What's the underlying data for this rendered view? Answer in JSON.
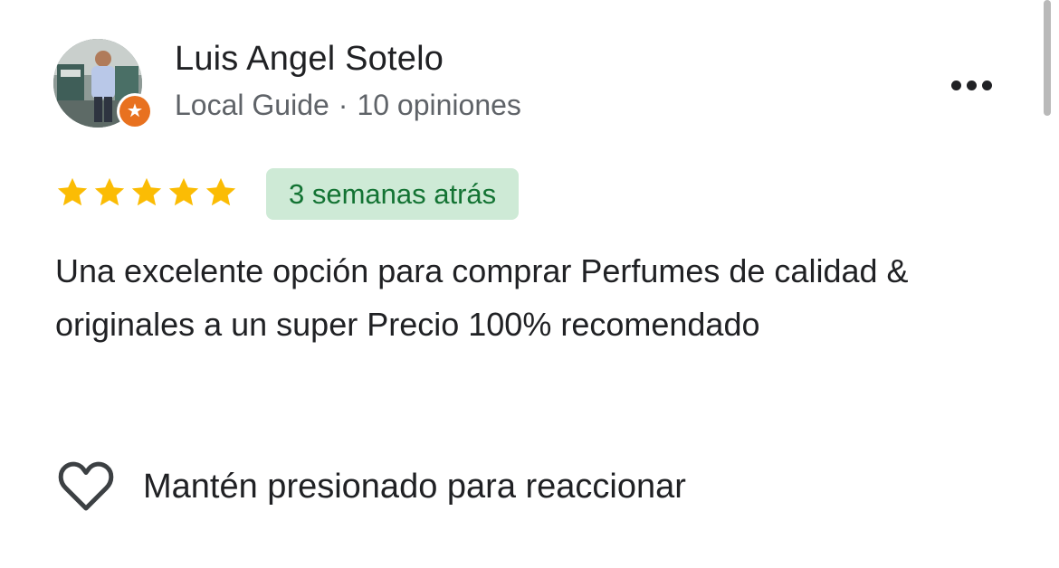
{
  "reviewer": {
    "name": "Luis Angel Sotelo",
    "role": "Local Guide",
    "separator": "·",
    "reviews_count": "10 opiniones",
    "avatar_icon": "reviewer-photo",
    "badge_icon": "local-guide-star-badge",
    "badge_color": "#e8711f"
  },
  "menu": {
    "icon": "more-horizontal-icon"
  },
  "rating": {
    "stars": 5,
    "max": 5,
    "star_color": "#fbbc04"
  },
  "time_ago": "3 semanas atrás",
  "review_text": "Una excelente opción para comprar Perfumes de calidad & originales a un super Precio 100% recomendado",
  "reaction": {
    "icon": "heart-outline-icon",
    "label": "Mantén presionado para reaccionar"
  },
  "colors": {
    "text_primary": "#202124",
    "text_secondary": "#5f6368",
    "badge_bg": "#ceead6",
    "badge_text": "#137333"
  }
}
